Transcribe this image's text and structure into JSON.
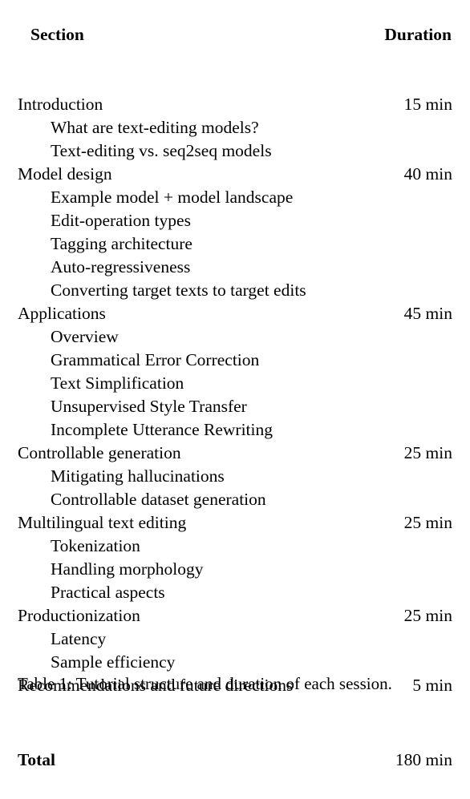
{
  "table": {
    "columns": {
      "section_header": "Section",
      "duration_header": "Duration"
    },
    "rows": [
      {
        "label": "Introduction",
        "duration": "15 min",
        "level": 0
      },
      {
        "label": "What are text-editing models?",
        "duration": "",
        "level": 1
      },
      {
        "label": "Text-editing vs. seq2seq models",
        "duration": "",
        "level": 1
      },
      {
        "label": "Model design",
        "duration": "40 min",
        "level": 0
      },
      {
        "label": "Example model + model landscape",
        "duration": "",
        "level": 1
      },
      {
        "label": "Edit-operation types",
        "duration": "",
        "level": 1
      },
      {
        "label": "Tagging architecture",
        "duration": "",
        "level": 1
      },
      {
        "label": "Auto-regressiveness",
        "duration": "",
        "level": 1
      },
      {
        "label": "Converting target texts to target edits",
        "duration": "",
        "level": 1
      },
      {
        "label": "Applications",
        "duration": "45 min",
        "level": 0
      },
      {
        "label": "Overview",
        "duration": "",
        "level": 1
      },
      {
        "label": "Grammatical Error Correction",
        "duration": "",
        "level": 1
      },
      {
        "label": "Text Simplification",
        "duration": "",
        "level": 1
      },
      {
        "label": "Unsupervised Style Transfer",
        "duration": "",
        "level": 1
      },
      {
        "label": "Incomplete Utterance Rewriting",
        "duration": "",
        "level": 1
      },
      {
        "label": "Controllable generation",
        "duration": "25 min",
        "level": 0
      },
      {
        "label": "Mitigating hallucinations",
        "duration": "",
        "level": 1
      },
      {
        "label": "Controllable dataset generation",
        "duration": "",
        "level": 1
      },
      {
        "label": "Multilingual text editing",
        "duration": "25 min",
        "level": 0
      },
      {
        "label": "Tokenization",
        "duration": "",
        "level": 1
      },
      {
        "label": "Handling morphology",
        "duration": "",
        "level": 1
      },
      {
        "label": "Practical aspects",
        "duration": "",
        "level": 1
      },
      {
        "label": "Productionization",
        "duration": "25 min",
        "level": 0
      },
      {
        "label": "Latency",
        "duration": "",
        "level": 1
      },
      {
        "label": "Sample efficiency",
        "duration": "",
        "level": 1
      },
      {
        "label": "Recommendations and future directions",
        "duration": "5 min",
        "level": 0
      }
    ],
    "total": {
      "label": "Total",
      "duration": "180 min"
    }
  },
  "caption": {
    "text": "Table 1: Tutorial structure and duration of each session."
  }
}
